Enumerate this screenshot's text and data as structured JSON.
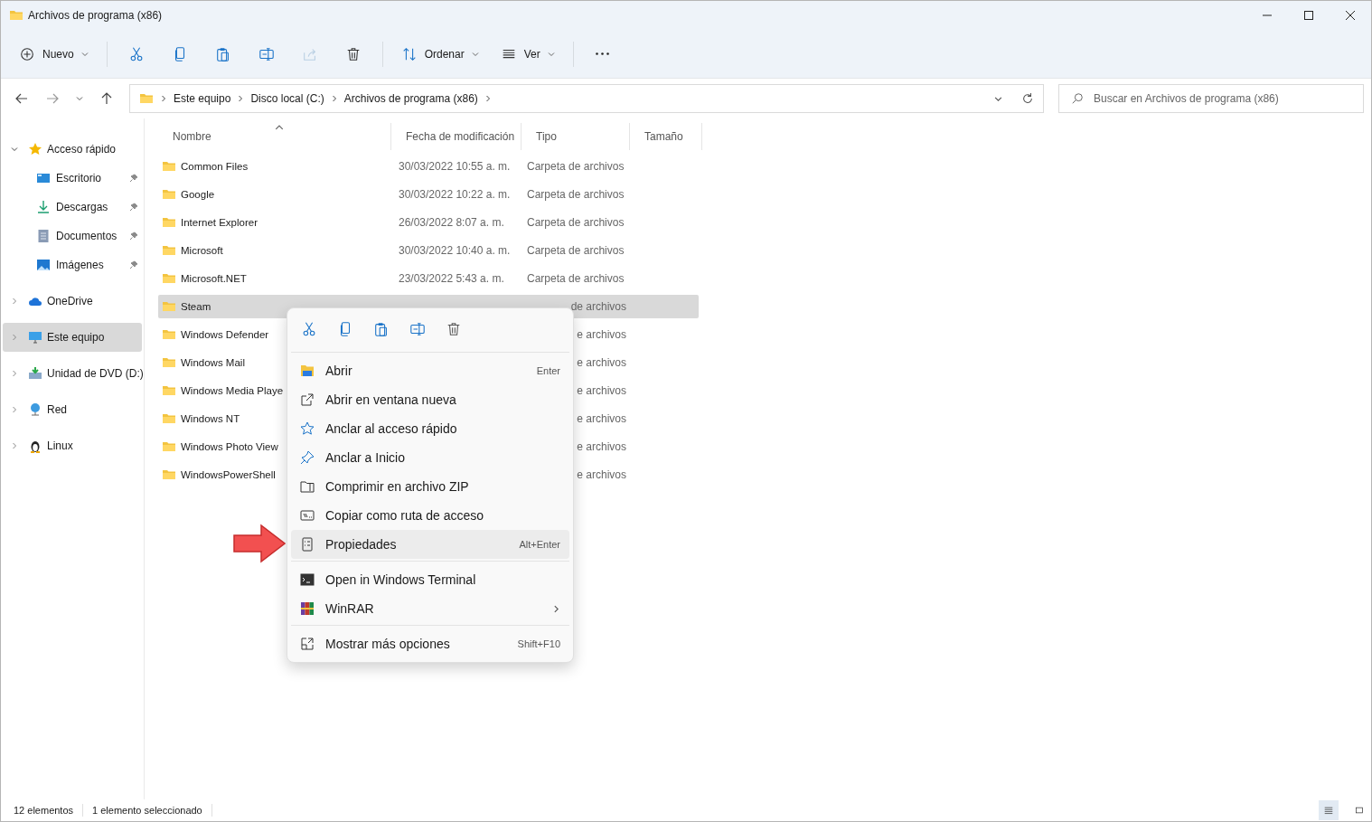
{
  "window": {
    "title": "Archivos de programa (x86)"
  },
  "toolbar": [
    {
      "kind": "new",
      "label": "Nuevo",
      "dropdown": true,
      "disabled": false
    },
    {
      "kind": "cut",
      "disabled": false
    },
    {
      "kind": "copy",
      "disabled": false
    },
    {
      "kind": "paste",
      "disabled": false
    },
    {
      "kind": "rename",
      "disabled": false
    },
    {
      "kind": "share",
      "disabled": true
    },
    {
      "kind": "delete",
      "disabled": false
    },
    {
      "kind": "sort",
      "label": "Ordenar",
      "dropdown": true,
      "disabled": false
    },
    {
      "kind": "view",
      "label": "Ver",
      "dropdown": true,
      "disabled": false
    },
    {
      "kind": "more",
      "disabled": false
    }
  ],
  "address": {
    "breadcrumb": [
      "Este equipo",
      "Disco local (C:)",
      "Archivos de programa (x86)"
    ]
  },
  "search": {
    "placeholder": "Buscar en Archivos de programa (x86)"
  },
  "sidebar": {
    "items": [
      {
        "kind": "star",
        "label": "Acceso rápido",
        "expanded": true,
        "selected": false,
        "children": [
          {
            "kind": "desktop",
            "label": "Escritorio",
            "pinned": true
          },
          {
            "kind": "download",
            "label": "Descargas",
            "pinned": true
          },
          {
            "kind": "documents",
            "label": "Documentos",
            "pinned": true
          },
          {
            "kind": "pictures",
            "label": "Imágenes",
            "pinned": true
          }
        ]
      },
      {
        "kind": "cloud",
        "label": "OneDrive",
        "expanded": false,
        "selected": false
      },
      {
        "kind": "computer",
        "label": "Este equipo",
        "expanded": false,
        "selected": true
      },
      {
        "kind": "dvd",
        "label": "Unidad de DVD (D:)",
        "expanded": false,
        "selected": false
      },
      {
        "kind": "network",
        "label": "Red",
        "expanded": false,
        "selected": false
      },
      {
        "kind": "penguin",
        "label": "Linux",
        "expanded": false,
        "selected": false
      }
    ]
  },
  "table": {
    "columns": [
      {
        "label": "Nombre",
        "sorted": true
      },
      {
        "label": "Fecha de modificación",
        "sorted": false
      },
      {
        "label": "Tipo",
        "sorted": false
      },
      {
        "label": "Tamaño",
        "sorted": false
      }
    ],
    "rows": [
      {
        "name": "Common Files",
        "date": "30/03/2022 10:55 a. m.",
        "type": "Carpeta de archivos",
        "selected": false,
        "covered": false
      },
      {
        "name": "Google",
        "date": "30/03/2022 10:22 a. m.",
        "type": "Carpeta de archivos",
        "selected": false,
        "covered": false
      },
      {
        "name": "Internet Explorer",
        "date": "26/03/2022 8:07 a. m.",
        "type": "Carpeta de archivos",
        "selected": false,
        "covered": false
      },
      {
        "name": "Microsoft",
        "date": "30/03/2022 10:40 a. m.",
        "type": "Carpeta de archivos",
        "selected": false,
        "covered": false
      },
      {
        "name": "Microsoft.NET",
        "date": "23/03/2022 5:43 a. m.",
        "type": "Carpeta de archivos",
        "selected": false,
        "covered": false
      },
      {
        "name": "Steam",
        "type": "de archivos",
        "selected": true,
        "covered": true
      },
      {
        "name": "Windows Defender",
        "type": "e archivos",
        "selected": false,
        "covered": true
      },
      {
        "name": "Windows Mail",
        "type": "e archivos",
        "selected": false,
        "covered": true
      },
      {
        "name": "Windows Media Playe",
        "type": "e archivos",
        "selected": false,
        "covered": true
      },
      {
        "name": "Windows NT",
        "type": "e archivos",
        "selected": false,
        "covered": true
      },
      {
        "name": "Windows Photo View",
        "type": "e archivos",
        "selected": false,
        "covered": true
      },
      {
        "name": "WindowsPowerShell",
        "type": "e archivos",
        "selected": false,
        "covered": true
      }
    ]
  },
  "context_menu": {
    "actions": [
      {
        "kind": "cut"
      },
      {
        "kind": "copy"
      },
      {
        "kind": "paste"
      },
      {
        "kind": "rename"
      },
      {
        "kind": "delete"
      }
    ],
    "groups": [
      [
        {
          "kind": "open",
          "label": "Abrir",
          "shortcut": "Enter",
          "selected": false,
          "submenu": false
        },
        {
          "kind": "new-window",
          "label": "Abrir en ventana nueva",
          "selected": false,
          "submenu": false
        },
        {
          "kind": "star",
          "label": "Anclar al acceso rápido",
          "selected": false,
          "submenu": false
        },
        {
          "kind": "pin",
          "label": "Anclar a Inicio",
          "selected": false,
          "submenu": false
        },
        {
          "kind": "zip",
          "label": "Comprimir en archivo ZIP",
          "selected": false,
          "submenu": false
        },
        {
          "kind": "path",
          "label": "Copiar como ruta de acceso",
          "selected": false,
          "submenu": false
        },
        {
          "kind": "properties",
          "label": "Propiedades",
          "shortcut": "Alt+Enter",
          "selected": true,
          "submenu": false
        }
      ],
      [
        {
          "kind": "terminal",
          "label": "Open in Windows Terminal",
          "selected": false,
          "submenu": false
        },
        {
          "kind": "winrar",
          "label": "WinRAR",
          "selected": false,
          "submenu": true
        }
      ],
      [
        {
          "kind": "more",
          "label": "Mostrar más opciones",
          "shortcut": "Shift+F10",
          "selected": false,
          "submenu": false
        }
      ]
    ]
  },
  "status_bar": {
    "count": "12 elementos",
    "selection": "1 elemento seleccionado"
  }
}
